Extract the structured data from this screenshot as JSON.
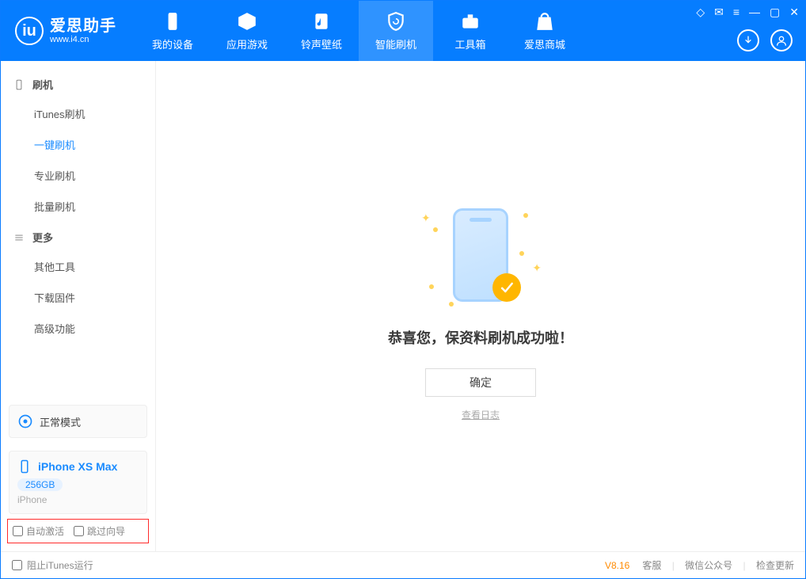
{
  "header": {
    "logo_cn": "爱思助手",
    "logo_en": "www.i4.cn",
    "nav": [
      "我的设备",
      "应用游戏",
      "铃声壁纸",
      "智能刷机",
      "工具箱",
      "爱思商城"
    ],
    "active_index": 3
  },
  "sidebar": {
    "sections": [
      {
        "title": "刷机",
        "items": [
          "iTunes刷机",
          "一键刷机",
          "专业刷机",
          "批量刷机"
        ],
        "active_index": 1
      },
      {
        "title": "更多",
        "items": [
          "其他工具",
          "下载固件",
          "高级功能"
        ],
        "active_index": -1
      }
    ],
    "mode": "正常模式",
    "device": {
      "name": "iPhone XS Max",
      "capacity": "256GB",
      "type": "iPhone"
    },
    "options": {
      "auto_activate": "自动激活",
      "skip_guide": "跳过向导"
    }
  },
  "main": {
    "success_text": "恭喜您，保资料刷机成功啦！",
    "ok_button": "确定",
    "view_log": "查看日志"
  },
  "footer": {
    "block_itunes": "阻止iTunes运行",
    "version": "V8.16",
    "links": [
      "客服",
      "微信公众号",
      "检查更新"
    ]
  }
}
